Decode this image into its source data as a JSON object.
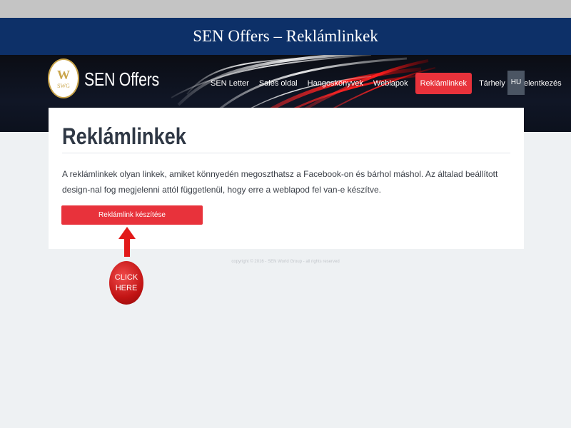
{
  "slide": {
    "title": "SEN Offers –  Reklámlinkek"
  },
  "header": {
    "logo_text": "W",
    "logo_sub": "SWG",
    "brand": "SEN Offers",
    "nav": [
      {
        "label": "SEN Letter"
      },
      {
        "label": "Sales oldal"
      },
      {
        "label": "Hangoskönyvek"
      },
      {
        "label": "Weblapok"
      },
      {
        "label": "Reklámlinkek",
        "active": true
      },
      {
        "label": "Tárhely"
      },
      {
        "label": "Kijelentkezés"
      }
    ],
    "lang": "HU"
  },
  "main": {
    "title": "Reklámlinkek",
    "description": "A reklámlinkek olyan linkek, amiket könnyedén megoszthatsz a Facebook-on és bárhol máshol. Az általad beállított design-nal fog megjelenni attól függetlenül, hogy erre a weblapod fel van-e készítve.",
    "button": "Reklámlink készítése"
  },
  "footer": {
    "copyright": "copyright © 2016 - SEN World Group - all rights reserved"
  },
  "annotation": {
    "line1": "CLICK",
    "line2": "HERE"
  },
  "colors": {
    "accent": "#e8323b",
    "title_bar": "#0d3068",
    "arrow": "#e21a1a"
  },
  "icons": {
    "logo": "swg-logo",
    "arrow": "arrow-up-icon"
  }
}
